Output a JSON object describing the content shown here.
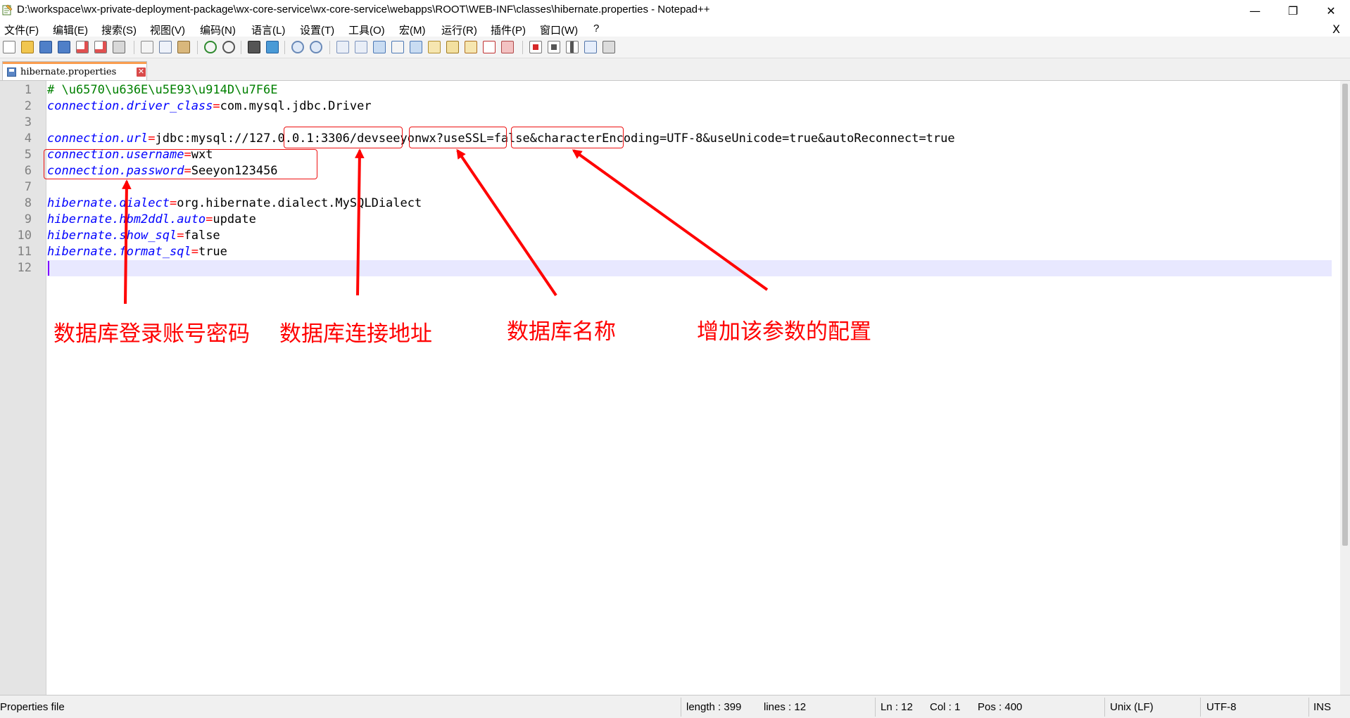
{
  "window": {
    "title": "D:\\workspace\\wx-private-deployment-package\\wx-core-service\\wx-core-service\\webapps\\ROOT\\WEB-INF\\classes\\hibernate.properties - Notepad++",
    "minimize_glyph": "—",
    "restore_glyph": "❐",
    "close_glyph": "✕"
  },
  "menu": {
    "items": [
      "文件(F)",
      "编辑(E)",
      "搜索(S)",
      "视图(V)",
      "编码(N)",
      "语言(L)",
      "设置(T)",
      "工具(O)",
      "宏(M)",
      "运行(R)",
      "插件(P)",
      "窗口(W)",
      "?"
    ],
    "close_doc_glyph": "X"
  },
  "toolbar": {
    "icons": [
      "new-file-icon",
      "open-file-icon",
      "save-icon",
      "save-all-icon",
      "close-icon",
      "close-all-icon",
      "print-icon",
      "cut-icon",
      "copy-icon",
      "paste-icon",
      "undo-icon",
      "redo-icon",
      "find-icon",
      "replace-icon",
      "zoom-in-icon",
      "zoom-out-icon",
      "sync-vertical-icon",
      "sync-horizontal-icon",
      "word-wrap-icon",
      "show-all-chars-icon",
      "indent-guide-icon",
      "user-lang-icon",
      "doc-map-icon",
      "function-list-icon",
      "folder-workspace-icon",
      "monitoring-icon",
      "record-macro-icon",
      "stop-macro-icon",
      "play-macro-icon",
      "run-macro-multiple-icon",
      "save-macro-icon"
    ]
  },
  "tab": {
    "label": "hibernate.properties",
    "close_glyph": "✕"
  },
  "editor": {
    "line_numbers": [
      "1",
      "2",
      "3",
      "4",
      "5",
      "6",
      "7",
      "8",
      "9",
      "10",
      "11",
      "12"
    ],
    "lines": [
      {
        "comment": "# \\u6570\\u636E\\u5E93\\u914D\\u7F6E"
      },
      {
        "key": "connection.driver_class",
        "eq": "=",
        "val": "com.mysql.jdbc.Driver"
      },
      {},
      {
        "key": "connection.url",
        "eq": "=",
        "val": "jdbc:mysql://127.0.0.1:3306/devseeyonwx?useSSL=false&characterEncoding=UTF-8&useUnicode=true&autoReconnect=true"
      },
      {
        "key": "connection.username",
        "eq": "=",
        "val": "wxt"
      },
      {
        "key": "connection.password",
        "eq": "=",
        "val": "Seeyon123456"
      },
      {},
      {
        "key": "hibernate.dialect",
        "eq": "=",
        "val": "org.hibernate.dialect.MySQLDialect"
      },
      {
        "key": "hibernate.hbm2ddl.auto",
        "eq": "=",
        "val": "update"
      },
      {
        "key": "hibernate.show_sql",
        "eq": "=",
        "val": "false"
      },
      {
        "key": "hibernate.format_sql",
        "eq": "=",
        "val": "true"
      },
      {}
    ],
    "current_line": 12
  },
  "annotations": {
    "account_label": "数据库登录账号密码",
    "address_label": "数据库连接地址",
    "dbname_label": "数据库名称",
    "param_label": "增加该参数的配置"
  },
  "status": {
    "file_type": "Properties file",
    "length": "length : 399",
    "lines": "lines : 12",
    "ln": "Ln : 12",
    "col": "Col : 1",
    "pos": "Pos : 400",
    "eol": "Unix (LF)",
    "encoding": "UTF-8",
    "mode": "INS"
  },
  "colors": {
    "comment": "#008000",
    "key": "#0000ff",
    "operator": "#ff0000",
    "annotation": "#ff0000",
    "current_line_bg": "#e8e8ff",
    "tab_accent": "#fa9d4f"
  }
}
